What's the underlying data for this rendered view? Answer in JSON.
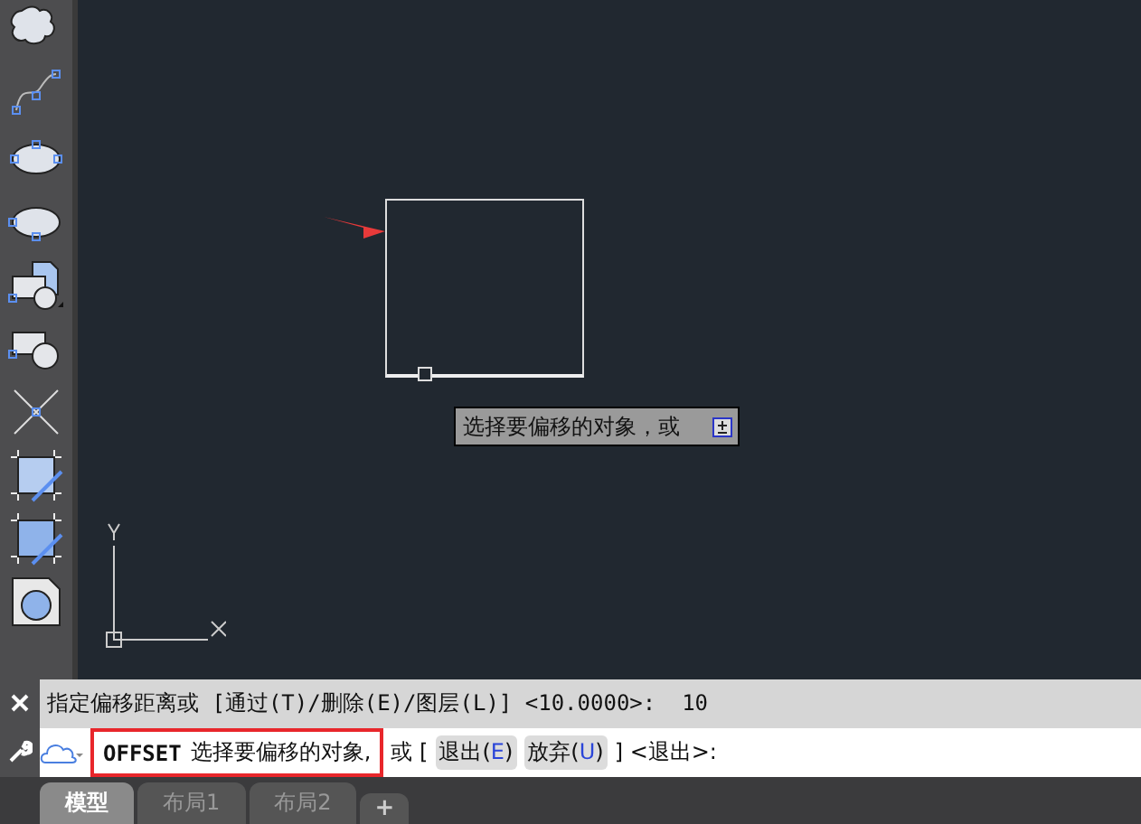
{
  "history_line": "指定偏移距离或 [通过(T)/删除(E)/图层(L)] <10.0000>:  10",
  "command": {
    "name": "OFFSET",
    "prompt": "选择要偏移的对象,",
    "highlighted": true,
    "between": "或 [",
    "options": [
      {
        "text": "退出(",
        "key": "E",
        "end": ")"
      },
      {
        "text": "放弃(",
        "key": "U",
        "end": ")"
      }
    ],
    "tail": "] <退出>:"
  },
  "tooltip": {
    "text": "选择要偏移的对象，或"
  },
  "tabs": [
    {
      "label": "模型",
      "selected": true
    },
    {
      "label": "布局1",
      "selected": false
    },
    {
      "label": "布局2",
      "selected": false
    }
  ],
  "new_tab": "+"
}
